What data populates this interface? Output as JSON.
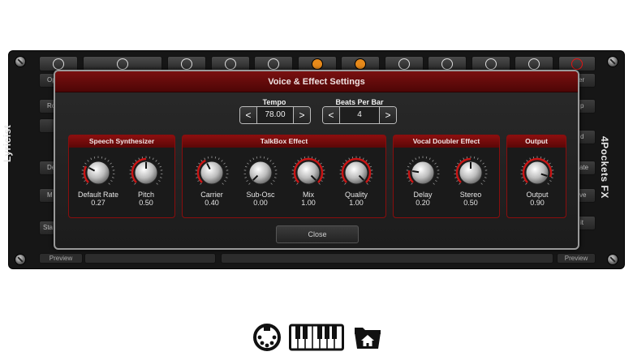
{
  "rack": {
    "left_label": "Lyricist",
    "right_label": "4Pockets FX",
    "side_left": [
      "Op",
      "Ro",
      "De",
      "M",
      "Sta",
      "Preview"
    ],
    "side_right": [
      "er",
      "p",
      "d",
      "ate",
      "ve",
      "it",
      "Preview"
    ]
  },
  "dialog": {
    "title": "Voice & Effect Settings",
    "close_label": "Close"
  },
  "tempo": {
    "label": "Tempo",
    "value": "78.00",
    "dec": "<",
    "inc": ">"
  },
  "beats": {
    "label": "Beats Per Bar",
    "value": "4",
    "dec": "<",
    "inc": ">"
  },
  "groups": [
    {
      "title": "Speech Synthesizer",
      "knobs": [
        {
          "label": "Default Rate",
          "value": "0.27"
        },
        {
          "label": "Pitch",
          "value": "0.50"
        }
      ]
    },
    {
      "title": "TalkBox Effect",
      "knobs": [
        {
          "label": "Carrier",
          "value": "0.40"
        },
        {
          "label": "Sub-Osc",
          "value": "0.00"
        },
        {
          "label": "Mix",
          "value": "1.00"
        },
        {
          "label": "Quality",
          "value": "1.00"
        }
      ]
    },
    {
      "title": "Vocal Doubler Effect",
      "knobs": [
        {
          "label": "Delay",
          "value": "0.20"
        },
        {
          "label": "Stereo",
          "value": "0.50"
        }
      ]
    },
    {
      "title": "Output",
      "knobs": [
        {
          "label": "Output",
          "value": "0.90"
        }
      ]
    }
  ],
  "knob_levels": [
    0.27,
    0.5,
    0.4,
    0.0,
    1.0,
    1.0,
    0.2,
    0.5,
    0.9
  ],
  "colors": {
    "accent_red": "#c81414",
    "header_red": "#7a1010",
    "orange": "#e88a1a"
  },
  "bottom_icons": [
    "midi-port-icon",
    "piano-keyboard-icon",
    "folder-home-icon"
  ]
}
